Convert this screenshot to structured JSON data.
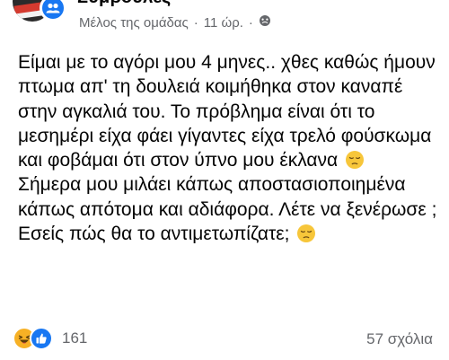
{
  "header": {
    "group_name": "Συμβουλές",
    "role": "Μέλος της ομάδας",
    "separator": "·",
    "time": "11 ώρ.",
    "separator2": "·",
    "privacy_icon": "group-privacy-icon"
  },
  "post": {
    "paragraph1": "Είμαι με το αγόρι μου 4 μηνες.. χθες καθώς ήμουν πτωμα απ' τη δουλειά κοιμήθηκα στον καναπέ στην αγκαλιά του. Το πρόβλημα είναι ότι το μεσημέρι είχα φάει γίγαντες είχα τρελό φούσκωμα και φοβάμαι ότι στον ύπνο μου έκλανα",
    "paragraph2": "Σήμερα μου μιλάει κάπως αποστασιοποιημένα κάπως απότομα και αδιάφορα. Λέτε να ξενέρωσε ; Εσείς πώς θα το αντιμετωπίζατε;",
    "emoji": "pensive-face-emoji"
  },
  "footer": {
    "reaction_count": "161",
    "comments": "57 σχόλια",
    "reaction_icons": [
      "haha-reaction-icon",
      "like-reaction-icon"
    ]
  },
  "colors": {
    "accent": "#1877f2",
    "secondary_text": "#65676b",
    "haha": "#f7b125"
  }
}
